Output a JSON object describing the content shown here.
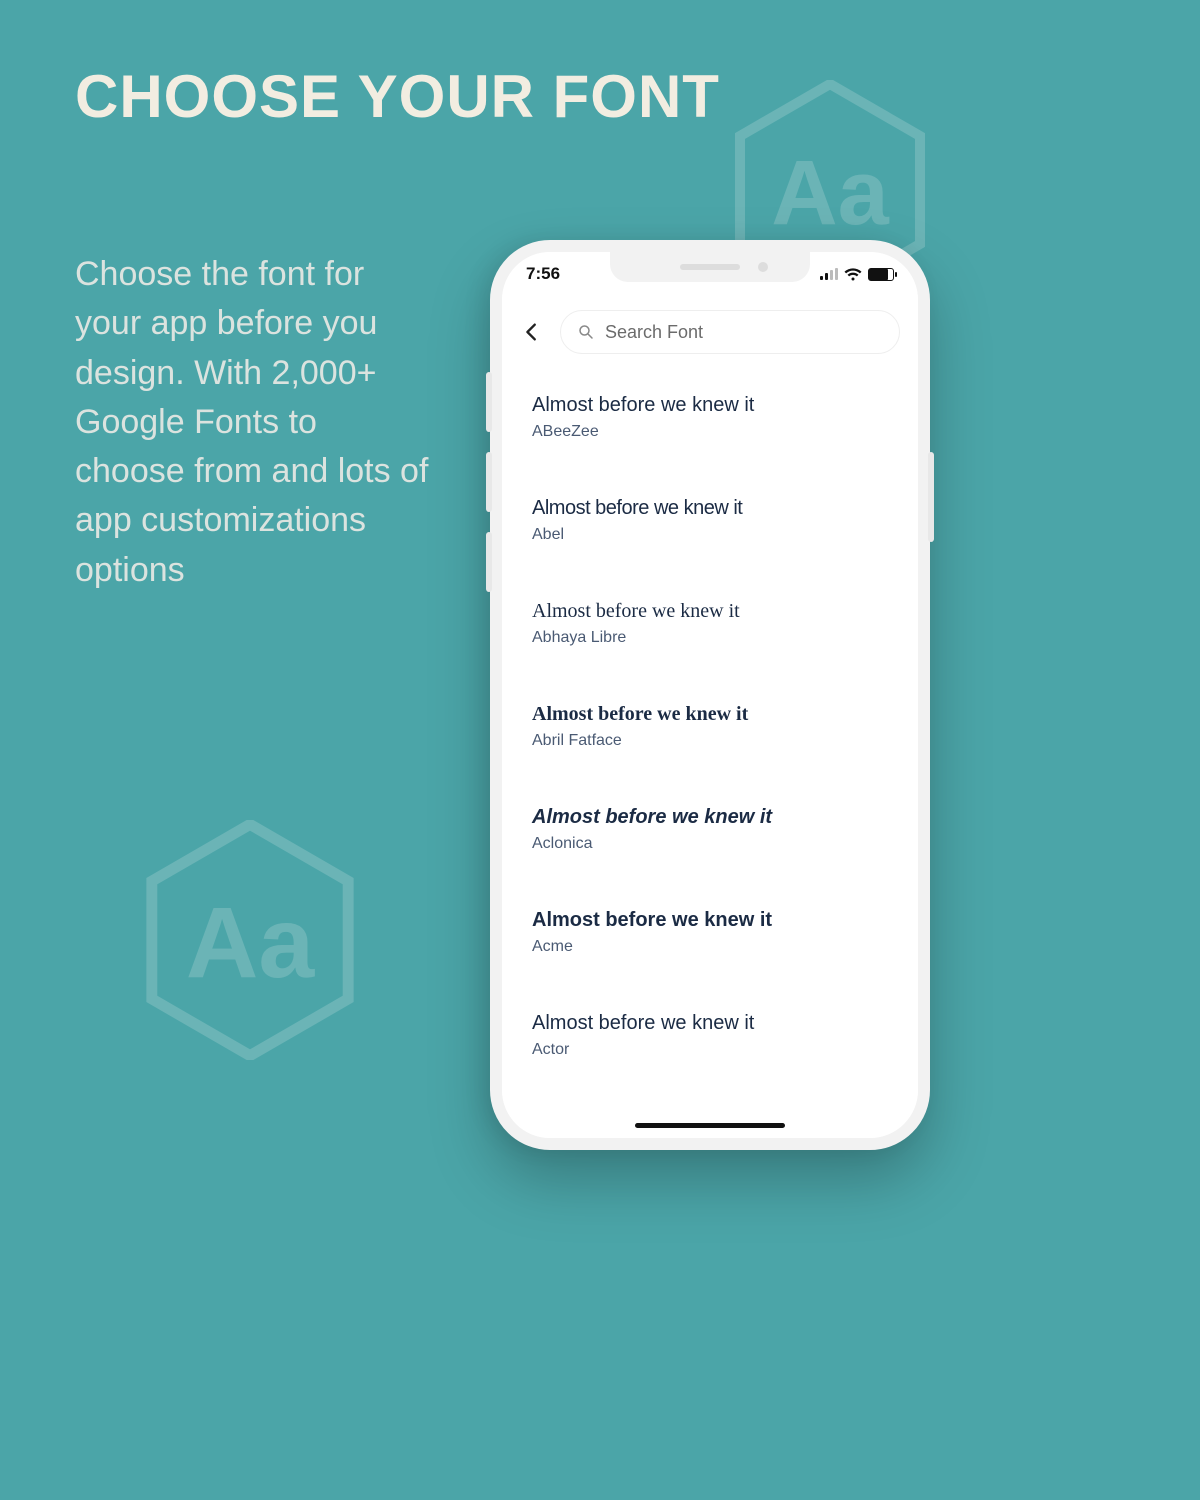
{
  "promo": {
    "title": "CHOOSE YOUR FONT",
    "description": "Choose the font for your app before you design. With 2,000+ Google Fonts to choose from and lots of app customizations options"
  },
  "statusbar": {
    "time": "7:56"
  },
  "search": {
    "placeholder": "Search Font"
  },
  "preview_text": "Almost before we knew it",
  "fonts": [
    {
      "name": "ABeeZee",
      "style": "font-family: Arial, sans-serif;"
    },
    {
      "name": "Abel",
      "style": "font-family: 'Helvetica Neue', Arial, sans-serif; font-stretch: condensed; letter-spacing: -0.5px; font-weight: 300;"
    },
    {
      "name": "Abhaya Libre",
      "style": "font-family: Georgia, 'Times New Roman', serif;"
    },
    {
      "name": "Abril Fatface",
      "style": "font-family: 'Bodoni MT', Didot, 'Times New Roman', serif; font-weight: 900;"
    },
    {
      "name": "Aclonica",
      "style": "font-family: 'Trebuchet MS', Verdana, sans-serif; font-weight: 700; font-style: italic;"
    },
    {
      "name": "Acme",
      "style": "font-family: Tahoma, Arial, sans-serif; font-weight: 700;"
    },
    {
      "name": "Actor",
      "style": "font-family: Arial, sans-serif;"
    }
  ]
}
